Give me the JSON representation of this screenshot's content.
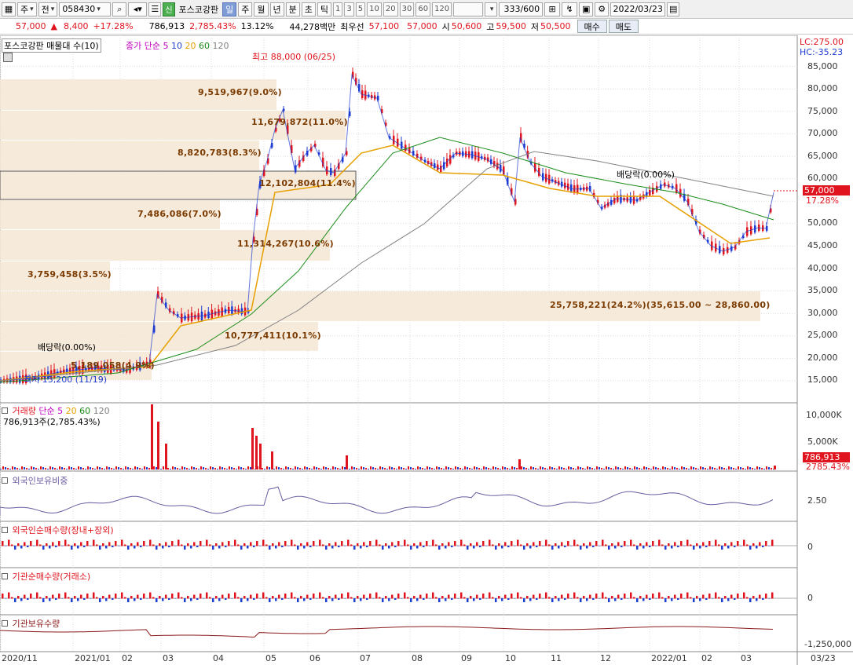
{
  "toolbar": {
    "market": "주",
    "period_select": "전",
    "code": "058430",
    "shin": "신",
    "stock_name": "포스코강판",
    "periods": [
      "일",
      "주",
      "월",
      "년",
      "분",
      "초",
      "틱"
    ],
    "intervals": [
      "1",
      "3",
      "5",
      "10",
      "20",
      "30",
      "60",
      "120"
    ],
    "count": "333",
    "count_total": "/600",
    "date": "2022/03/23"
  },
  "quote": {
    "price": "57,000",
    "change_arrow": "▲",
    "change": "8,400",
    "change_pct": "+17.28%",
    "volume": "786,913",
    "volume_pct": "2,785.43%",
    "turnover_pct": "13.12%",
    "amount": "44,278백만",
    "best_label": "최우선",
    "best_ask": "57,100",
    "best_bid": "57,000",
    "open_label": "시",
    "open": "50,600",
    "high_label": "고",
    "high": "59,500",
    "low_label": "저",
    "low": "50,500",
    "buy_label": "매수",
    "sell_label": "매도"
  },
  "main_panel": {
    "title": "포스코강판 매물대 수(10)",
    "ma_label": "종가 단순",
    "ma_periods": [
      "5",
      "10",
      "20",
      "60",
      "120"
    ],
    "ma_colors": [
      "#c000c0",
      "#1e3cd2",
      "#e6a000",
      "#1a8c1a",
      "#808080"
    ],
    "lc": "LC:275.00",
    "hc": "HC:-35.23",
    "high_annot": "최고 88,000 (06/25)",
    "low_annot": "최저 15,200 (11/19)",
    "dividend1": "배당락(0.00%)",
    "dividend2": "배당락(0.00%)",
    "last_price": "57,000",
    "last_pct": "17.28%",
    "y_ticks": [
      "85,000",
      "80,000",
      "75,000",
      "70,000",
      "65,000",
      "60,000",
      "55,000",
      "50,000",
      "45,000",
      "40,000",
      "35,000",
      "30,000",
      "25,000",
      "20,000",
      "15,000"
    ],
    "volume_profile": [
      {
        "label": "9,519,967(9.0%)"
      },
      {
        "label": "11,679,872(11.0%)"
      },
      {
        "label": "8,820,783(8.3%)"
      },
      {
        "label": "12,102,804(11.4%)"
      },
      {
        "label": "7,486,086(7.0%)"
      },
      {
        "label": "11,314,267(10.6%)"
      },
      {
        "label": "3,759,458(3.5%)"
      },
      {
        "label": "25,758,221(24.2%)(35,615.00 ~ 28,860.00)"
      },
      {
        "label": "10,777,411(10.1%)"
      },
      {
        "label": "5,189,058(4.9%)"
      }
    ]
  },
  "volume_panel": {
    "title": "거래량",
    "ma_label": "단순",
    "ma_periods": [
      "5",
      "20",
      "60",
      "120"
    ],
    "summary": "786,913주(2,785.43%)",
    "y_ticks": [
      "10,000K",
      "5,000K"
    ],
    "last_value": "786,913",
    "last_pct": "2785.43%"
  },
  "foreign_ratio_panel": {
    "title": "외국인보유비중",
    "y_tick": "2.50"
  },
  "foreign_net_panel": {
    "title": "외국인순매수량(장내+장외)",
    "y_tick": "0"
  },
  "inst_net_panel": {
    "title": "기관순매수량(거래소)",
    "y_tick": "0"
  },
  "inst_hold_panel": {
    "title": "기관보유수량",
    "y_tick": "-1,250,000"
  },
  "x_axis": [
    "2020/11",
    "2021/01",
    "02",
    "03",
    "04",
    "05",
    "06",
    "07",
    "08",
    "09",
    "10",
    "11",
    "12",
    "2022/01",
    "02",
    "03"
  ],
  "x_axis_right": "03/23"
}
